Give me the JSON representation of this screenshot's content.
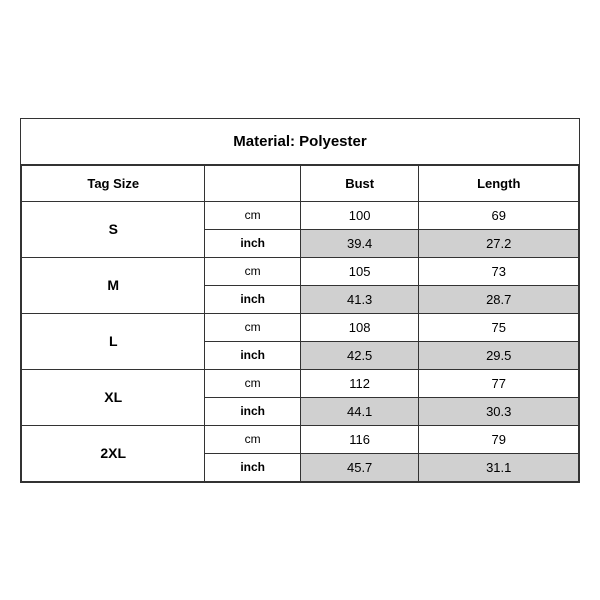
{
  "title": "Material: Polyester",
  "columns": {
    "tag_size": "Tag Size",
    "bust": "Bust",
    "length": "Length"
  },
  "sizes": [
    {
      "label": "S",
      "cm": {
        "bust": "100",
        "length": "69"
      },
      "inch": {
        "bust": "39.4",
        "length": "27.2"
      }
    },
    {
      "label": "M",
      "cm": {
        "bust": "105",
        "length": "73"
      },
      "inch": {
        "bust": "41.3",
        "length": "28.7"
      }
    },
    {
      "label": "L",
      "cm": {
        "bust": "108",
        "length": "75"
      },
      "inch": {
        "bust": "42.5",
        "length": "29.5"
      }
    },
    {
      "label": "XL",
      "cm": {
        "bust": "112",
        "length": "77"
      },
      "inch": {
        "bust": "44.1",
        "length": "30.3"
      }
    },
    {
      "label": "2XL",
      "cm": {
        "bust": "116",
        "length": "79"
      },
      "inch": {
        "bust": "45.7",
        "length": "31.1"
      }
    }
  ],
  "units": {
    "cm": "cm",
    "inch": "inch"
  }
}
